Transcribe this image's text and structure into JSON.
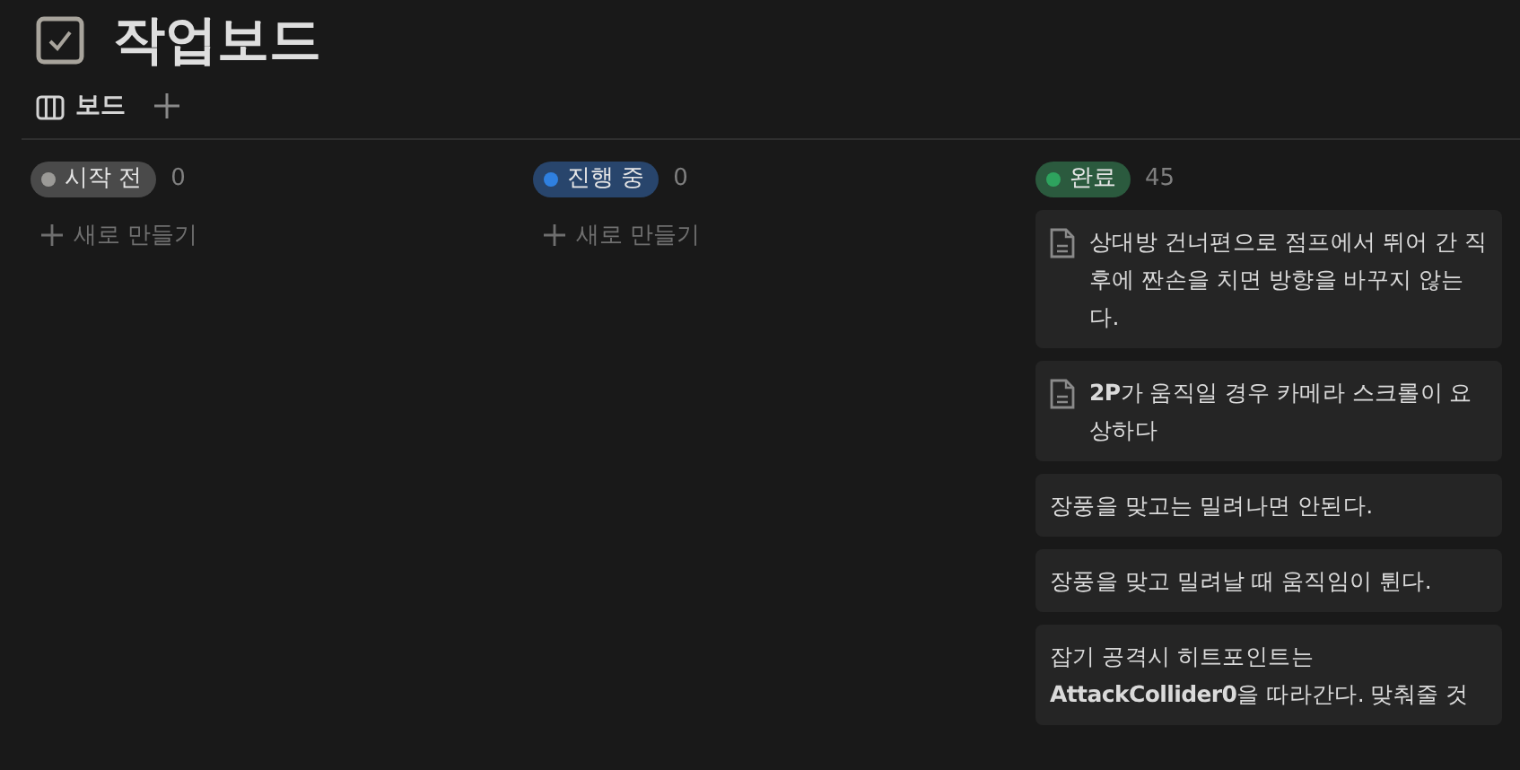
{
  "page": {
    "title": "작업보드"
  },
  "views": [
    {
      "label": "보드",
      "selected": true
    }
  ],
  "columns": [
    {
      "name": "시작 전",
      "color": "#9b9a97",
      "count": "0",
      "new_label": "새로 만들기"
    },
    {
      "name": "진행 중",
      "color": "#2f80e0",
      "count": "0",
      "new_label": "새로 만들기"
    },
    {
      "name": "완료",
      "color": "#2ea35e",
      "count": "45",
      "cards": [
        {
          "kind": "page",
          "text": "상대방 건너편으로 점프에서 뛰어 간 직후에 짠손을 치면 방향을 바꾸지 않는다."
        },
        {
          "kind": "page",
          "text": "**2P**가 움직일 경우 카메라 스크롤이 요상하다"
        },
        {
          "kind": "text",
          "text": "장풍을 맞고는 밀려나면 안된다."
        },
        {
          "kind": "text",
          "text": "장풍을 맞고 밀려날 때 움직임이 튄다."
        },
        {
          "kind": "text",
          "text": "잡기 공격시 히트포인트는 **AttackCollider0**을 따라간다. 맞춰줄 것"
        }
      ]
    }
  ]
}
